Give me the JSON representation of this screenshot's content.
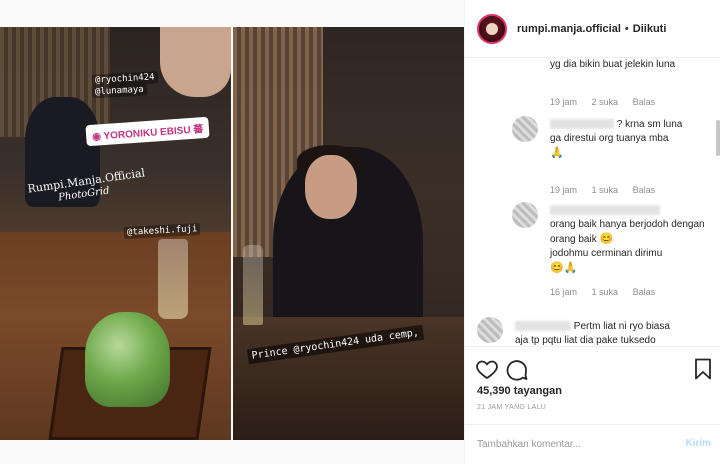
{
  "post": {
    "author": "rumpi.manja.official",
    "separator": "•",
    "follow_status": "Diikuti"
  },
  "photo": {
    "tag_user1": "@ryochin424",
    "tag_user2": "@lunamaya",
    "location_icon": "location-pin-icon",
    "location": "YORONIKU EBISU 蕃",
    "watermark_line1": "Rumpi.Manja.Official",
    "watermark_line2": "PhotoGrid",
    "tag_user3": "@takeshi.fuji",
    "caption_right": "Prince @ryochin424 uda cemp,"
  },
  "comments": [
    {
      "text": "yg dia bikin buat jelekin luna",
      "time": "19 jam",
      "likes": "2 suka",
      "reply": "Balas"
    },
    {
      "text_line1": "? krna sm luna",
      "text_line2": "ga direstui org tuanya mba",
      "emoji": "🙏",
      "time": "19 jam",
      "likes": "1 suka",
      "reply": "Balas"
    },
    {
      "text": "orang baik hanya berjodoh dengan orang baik",
      "emoji1": "😊",
      "text2": "jodohmu cerminan dirimu",
      "emoji2": "😊🙏",
      "time": "16 jam",
      "likes": "1 suka",
      "reply": "Balas"
    },
    {
      "text_line1": "Pertm liat ni ryo biasa",
      "text_line2": "aja tp pqtu liat dia pake tuksedo"
    }
  ],
  "stats": {
    "views": "45,390 tayangan",
    "posted": "21 JAM YANG LALU"
  },
  "composer": {
    "placeholder": "Tambahkan komentar...",
    "send": "Kirim"
  }
}
